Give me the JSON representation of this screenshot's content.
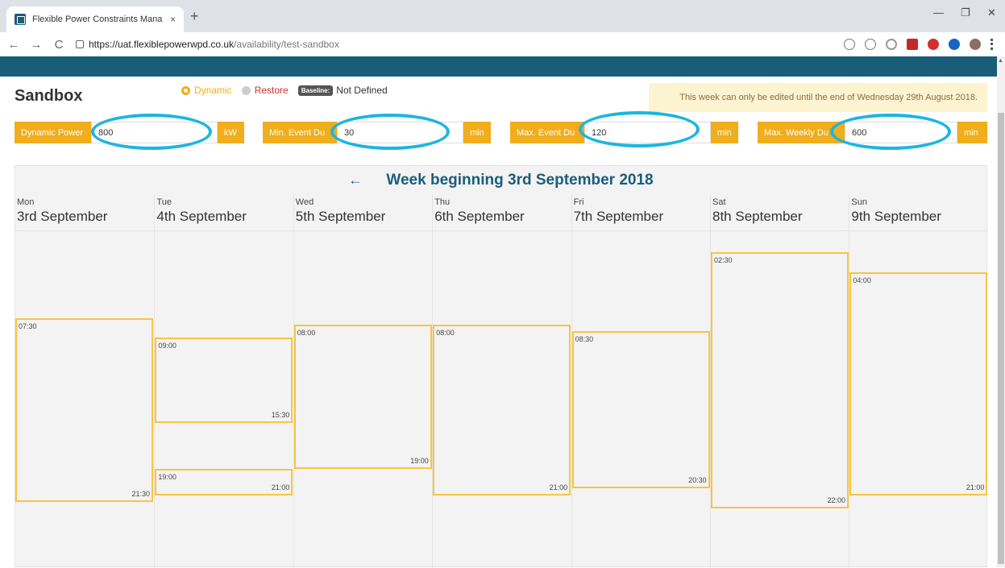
{
  "browser": {
    "tab_title": "Flexible Power Constraints Mana",
    "tab_close": "×",
    "new_tab": "+",
    "url_domain": "https://uat.flexiblepowerwpd.co.uk",
    "url_path": "/availability/test-sandbox",
    "minimize": "—",
    "restore": "❐",
    "close": "✕",
    "back": "←",
    "forward": "→",
    "reload": "C"
  },
  "page": {
    "title": "Sandbox",
    "modes": {
      "dynamic": "Dynamic",
      "restore": "Restore",
      "baseline_badge": "Baseline:",
      "baseline_value": "Not Defined"
    },
    "notice": "This week can only be edited until the end of Wednesday 29th August 2018."
  },
  "params": [
    {
      "label": "Dynamic Power",
      "value": "800",
      "unit": "kW"
    },
    {
      "label": "Min. Event Du",
      "value": "30",
      "unit": "min"
    },
    {
      "label": "Max. Event Du",
      "value": "120",
      "unit": "min"
    },
    {
      "label": "Max. Weekly Du",
      "value": "600",
      "unit": "min"
    }
  ],
  "calendar": {
    "prev_arrow": "←",
    "week_title": "Week beginning 3rd September 2018",
    "days": [
      {
        "name": "Mon",
        "date": "3rd September"
      },
      {
        "name": "Tue",
        "date": "4th September"
      },
      {
        "name": "Wed",
        "date": "5th September"
      },
      {
        "name": "Thu",
        "date": "6th September"
      },
      {
        "name": "Fri",
        "date": "7th September"
      },
      {
        "name": "Sat",
        "date": "8th September"
      },
      {
        "name": "Sun",
        "date": "9th September"
      }
    ],
    "events": [
      {
        "day": 0,
        "start": "07:30",
        "end": "21:30"
      },
      {
        "day": 1,
        "start": "09:00",
        "end": "15:30"
      },
      {
        "day": 1,
        "start": "19:00",
        "end": "21:00"
      },
      {
        "day": 2,
        "start": "08:00",
        "end": "19:00"
      },
      {
        "day": 3,
        "start": "08:00",
        "end": "21:00"
      },
      {
        "day": 4,
        "start": "08:30",
        "end": "20:30"
      },
      {
        "day": 5,
        "start": "02:30",
        "end": "22:00"
      },
      {
        "day": 6,
        "start": "04:00",
        "end": "21:00"
      }
    ]
  },
  "colors": {
    "accent": "#f0ad1c",
    "brand": "#1a5d7a",
    "event_border": "#f7c542",
    "annotation": "#1bb6e0"
  }
}
